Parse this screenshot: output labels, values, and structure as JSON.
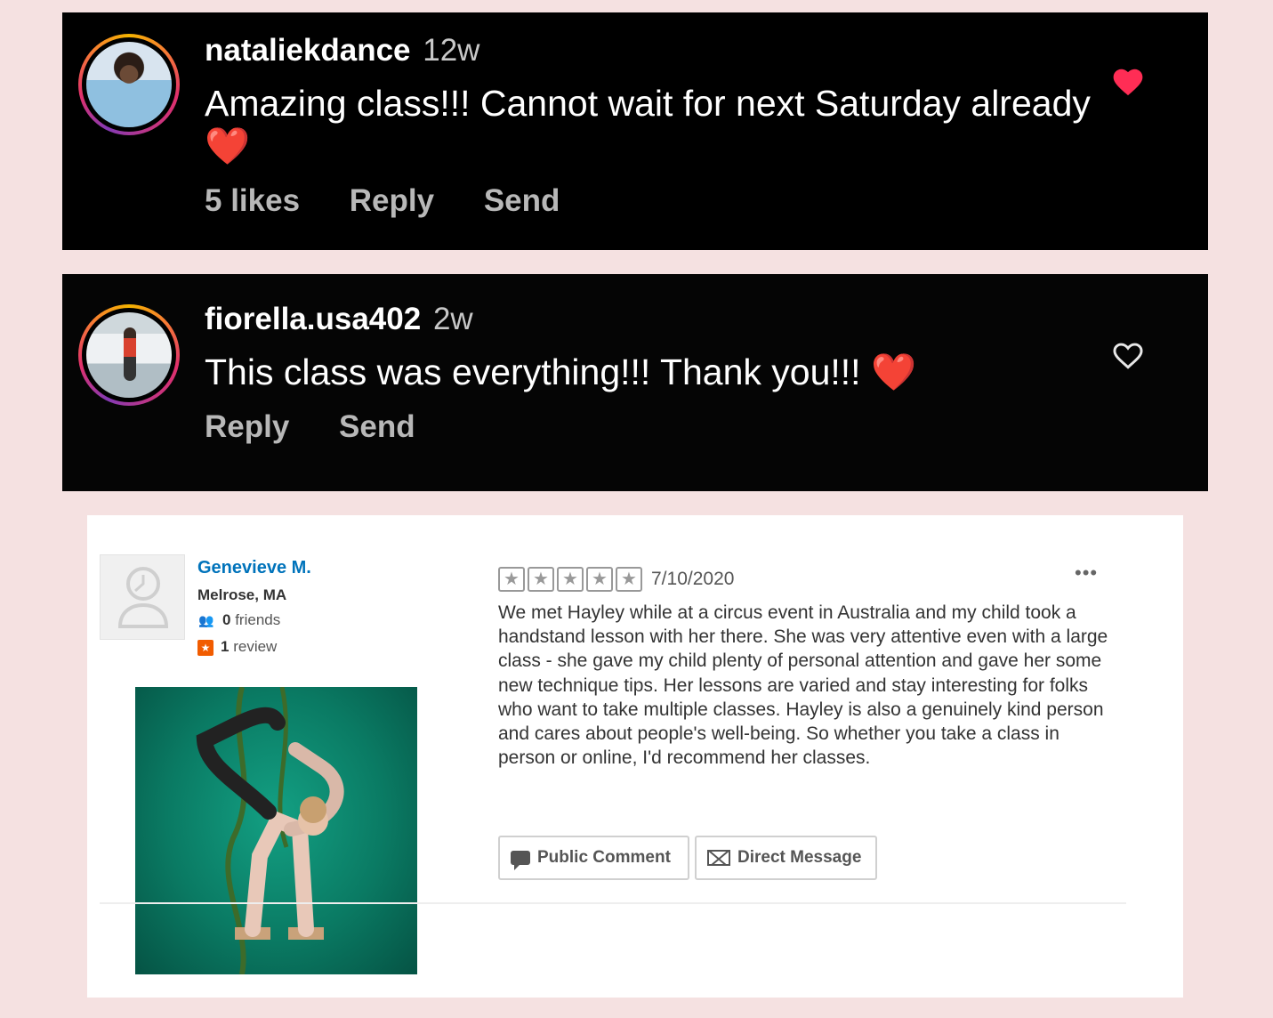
{
  "comments": [
    {
      "username": "nataliekdance",
      "time": "12w",
      "text": "Amazing class!!! Cannot wait for next Saturday already",
      "emoji": "❤️",
      "likes": "5 likes",
      "reply": "Reply",
      "send": "Send",
      "liked": true,
      "like_icon": "heart-filled-icon"
    },
    {
      "username": "fiorella.usa402",
      "time": "2w",
      "text": "This class was everything!!! Thank you!!!",
      "emoji": "❤️",
      "reply": "Reply",
      "send": "Send",
      "liked": false,
      "like_icon": "heart-outline-icon"
    }
  ],
  "review": {
    "name": "Genevieve M.",
    "location": "Melrose, MA",
    "friends_count": "0",
    "friends_label": "friends",
    "reviews_count": "1",
    "reviews_label": "review",
    "rating": 5,
    "date": "7/10/2020",
    "more": "•••",
    "text": "We met Hayley while at a circus event in Australia and my child took a handstand lesson with her there. She was very attentive even with a large class - she gave my child plenty of personal attention and gave her some new technique tips. Her lessons are varied and stay interesting for folks who want to take multiple classes. Hayley is also a genuinely kind person and cares about people's well-being. So whether you take a class in person or online, I'd recommend her classes.",
    "public_comment_label": "Public Comment",
    "direct_message_label": "Direct Message"
  },
  "colors": {
    "page_bg": "#f5e1e1",
    "card_bg": "#000000",
    "like_red": "#ff2d55",
    "yelp_link": "#0073bb",
    "yelp_orange": "#f15c00"
  }
}
